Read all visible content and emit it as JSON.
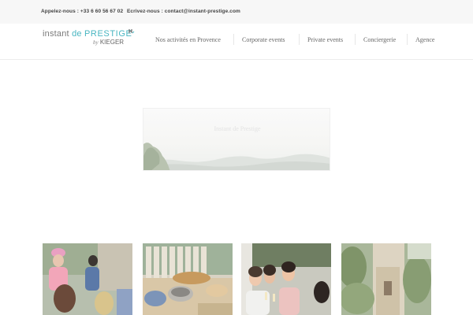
{
  "topbar": {
    "phone": "Appelez-nous : +33 6 60 56 67 02",
    "email": "Ecrivez-nous : contact@instant-prestige.com"
  },
  "logo": {
    "word1": "instant",
    "word2": "de",
    "word3": "PRESTIGE",
    "by": "by",
    "brand": "KIEGER"
  },
  "nav": {
    "items": [
      {
        "label": "Nos activités en Provence"
      },
      {
        "label": "Corporate events"
      },
      {
        "label": "Private events"
      },
      {
        "label": "Conciergerie"
      },
      {
        "label": "Agence"
      }
    ]
  },
  "hero": {
    "title": "Instant de Prestige"
  },
  "colors": {
    "accent": "#49b6c2",
    "topbar_bg": "#f7f7f7",
    "nav_text": "#666666"
  }
}
